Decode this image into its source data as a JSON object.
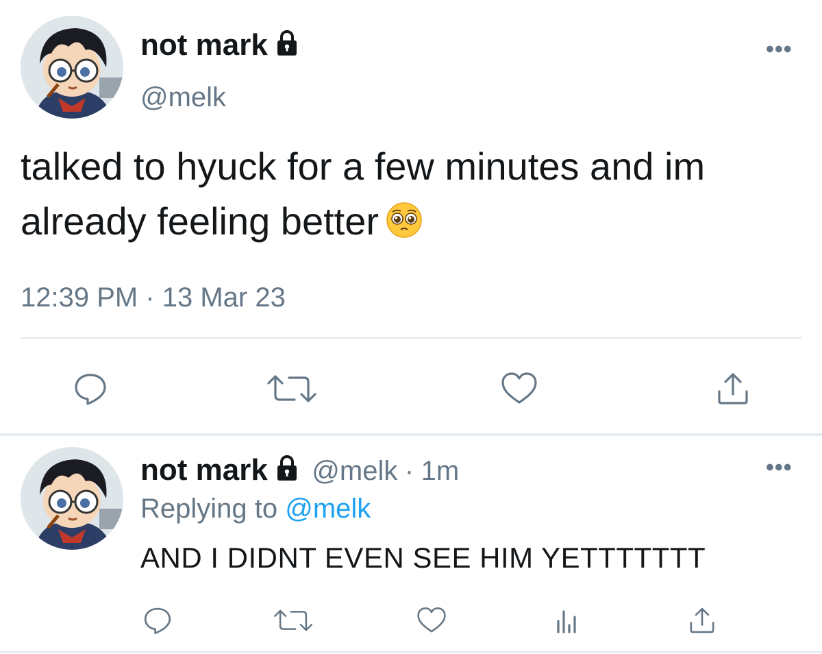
{
  "main_tweet": {
    "display_name": "not mark",
    "handle": "@melk",
    "more_label": "•••",
    "text": "talked to hyuck for a few minutes and im already feeling better",
    "emoji": "pleading-face-emoji",
    "timestamp": "12:39 PM · 13 Mar 23"
  },
  "reply_tweet": {
    "display_name": "not mark",
    "handle": "@melk",
    "separator": "·",
    "age": "1m",
    "more_label": "•••",
    "replying_prefix": "Replying to",
    "replying_handle": "@melk",
    "text": "AND I DIDNT EVEN SEE HIM YETTTTTTT"
  },
  "icons": {
    "main_actions": [
      "reply-icon",
      "retweet-icon",
      "like-icon",
      "share-icon"
    ],
    "reply_actions": [
      "reply-icon",
      "retweet-icon",
      "like-icon",
      "analytics-icon",
      "share-icon"
    ]
  },
  "colors": {
    "text": "#14171a",
    "secondary": "#657786",
    "link": "#1da1f2",
    "divider": "#e1e8ed"
  }
}
